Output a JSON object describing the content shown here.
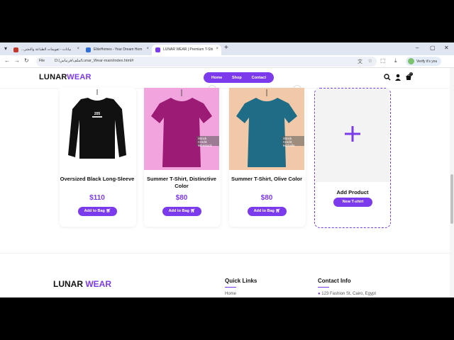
{
  "browser": {
    "tabs": [
      {
        "label": "...بيانات - تقويمات الطباعة والنشر",
        "color": "#c0392b"
      },
      {
        "label": "EliteHomes - Your Dream Hom",
        "color": "#2f6fd6"
      },
      {
        "label": "LUNAR WEAR | Premium T-Shi",
        "color": "#7c3aed"
      }
    ],
    "address": {
      "scheme_label": "File",
      "url": "D:/ملف/فرنباس/Lunar_Wear-main/index.html#"
    },
    "profile_label": "Verify it's you"
  },
  "site": {
    "logo_main": "LUNAR",
    "logo_accent": "WEAR",
    "nav": [
      "Home",
      "Shop",
      "Contact"
    ],
    "cart_count": "0",
    "accent_color": "#7c3aed"
  },
  "products": [
    {
      "title": "Oversized Black Long-Sleeve",
      "price": "$110",
      "button": "Add to Bag",
      "image": "black-longsleeve-shirt",
      "shirt_print": "205"
    },
    {
      "title": "Summer T-Shirt, Distinctive Color",
      "price": "$80",
      "button": "Add to Bag",
      "image": "magenta-tshirt",
      "watermark": "iStock",
      "credit": "Credit: Wirestock"
    },
    {
      "title": "Summer T-Shirt, Olive Color",
      "price": "$80",
      "button": "Add to Bag",
      "image": "teal-tshirt",
      "watermark": "iStock",
      "credit": "Credit: Michelle"
    }
  ],
  "add_product": {
    "label": "Add Product",
    "button": "New T-shirt"
  },
  "footer": {
    "logo_main": "LUNAR",
    "logo_accent": "WEAR",
    "quick_links_title": "Quick Links",
    "quick_links": [
      "Home"
    ],
    "contact_title": "Contact Info",
    "address": "123 Fashion St, Cairo, Egypt"
  }
}
